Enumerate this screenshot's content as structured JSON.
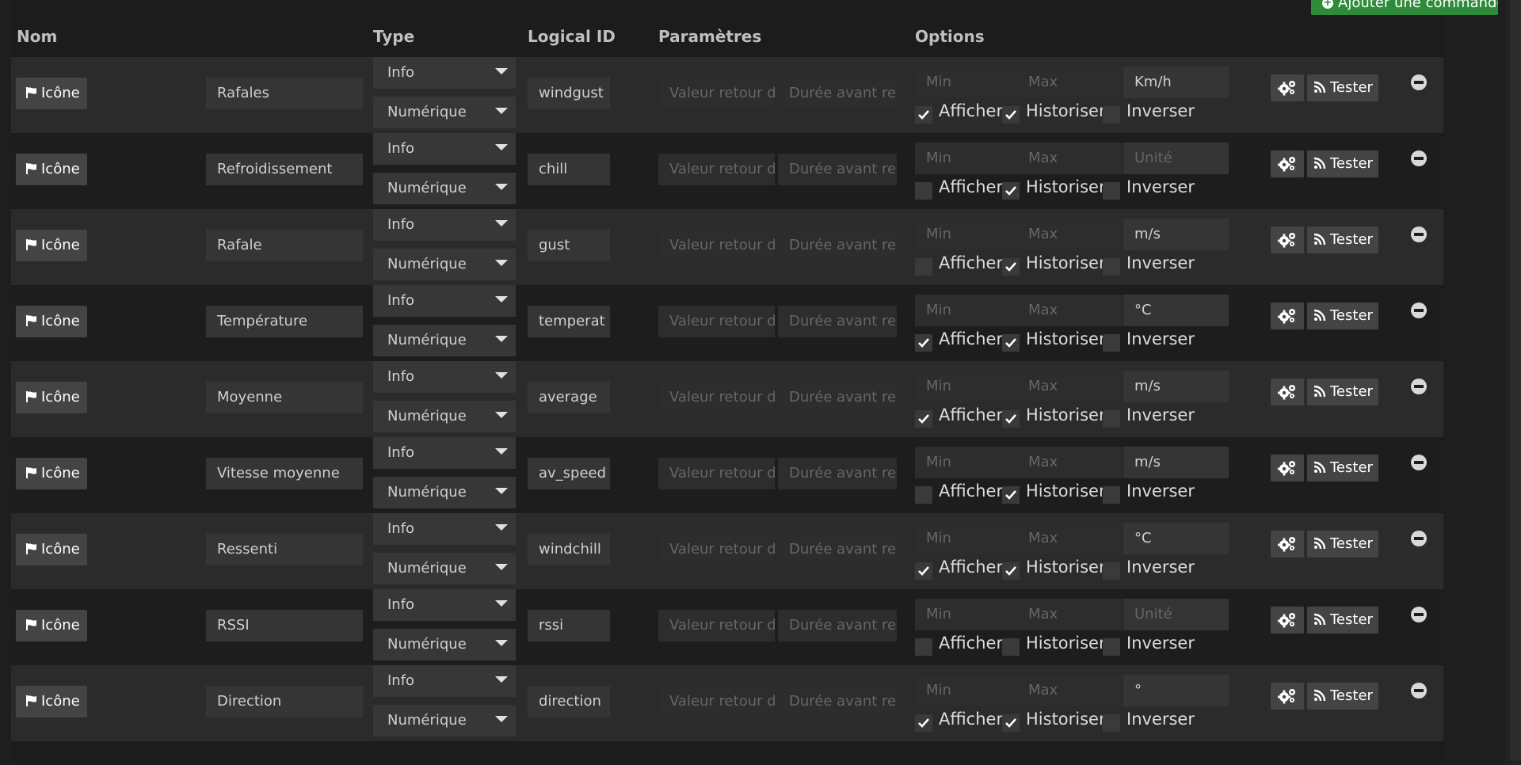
{
  "header": {
    "add_command_label": "Ajouter une commande",
    "columns": {
      "nom": "Nom",
      "type": "Type",
      "logical_id": "Logical ID",
      "parametres": "Paramètres",
      "options": "Options"
    }
  },
  "labels": {
    "icone": "Icône",
    "tester": "Tester",
    "afficher": "Afficher",
    "historiser": "Historiser",
    "inverser": "Inverser"
  },
  "placeholders": {
    "valeur_retour": "Valeur retour d",
    "duree_avant": "Durée avant re",
    "min": "Min",
    "max": "Max",
    "unite": "Unité"
  },
  "commands": [
    {
      "name": "Rafales",
      "type": "Info",
      "subtype": "Numérique",
      "logical_id": "windgust",
      "unit": "Km/h",
      "afficher": true,
      "historiser": true,
      "inverser": false
    },
    {
      "name": "Refroidissement",
      "type": "Info",
      "subtype": "Numérique",
      "logical_id": "chill",
      "unit": "",
      "afficher": false,
      "historiser": true,
      "inverser": false
    },
    {
      "name": "Rafale",
      "type": "Info",
      "subtype": "Numérique",
      "logical_id": "gust",
      "unit": "m/s",
      "afficher": false,
      "historiser": true,
      "inverser": false
    },
    {
      "name": "Température",
      "type": "Info",
      "subtype": "Numérique",
      "logical_id": "temperat",
      "unit": "°C",
      "afficher": true,
      "historiser": true,
      "inverser": false
    },
    {
      "name": "Moyenne",
      "type": "Info",
      "subtype": "Numérique",
      "logical_id": "average",
      "unit": "m/s",
      "afficher": true,
      "historiser": true,
      "inverser": false
    },
    {
      "name": "Vitesse moyenne",
      "type": "Info",
      "subtype": "Numérique",
      "logical_id": "av_speed",
      "unit": "m/s",
      "afficher": false,
      "historiser": true,
      "inverser": false
    },
    {
      "name": "Ressenti",
      "type": "Info",
      "subtype": "Numérique",
      "logical_id": "windchill",
      "unit": "°C",
      "afficher": true,
      "historiser": true,
      "inverser": false
    },
    {
      "name": "RSSI",
      "type": "Info",
      "subtype": "Numérique",
      "logical_id": "rssi",
      "unit": "",
      "afficher": false,
      "historiser": false,
      "inverser": false
    },
    {
      "name": "Direction",
      "type": "Info",
      "subtype": "Numérique",
      "logical_id": "direction",
      "unit": "°",
      "afficher": true,
      "historiser": true,
      "inverser": false
    }
  ],
  "colors": {
    "accent_green": "#2e8b3a",
    "row_odd": "#2b2b2b",
    "row_even": "#1d1d1d",
    "button": "#444444"
  }
}
